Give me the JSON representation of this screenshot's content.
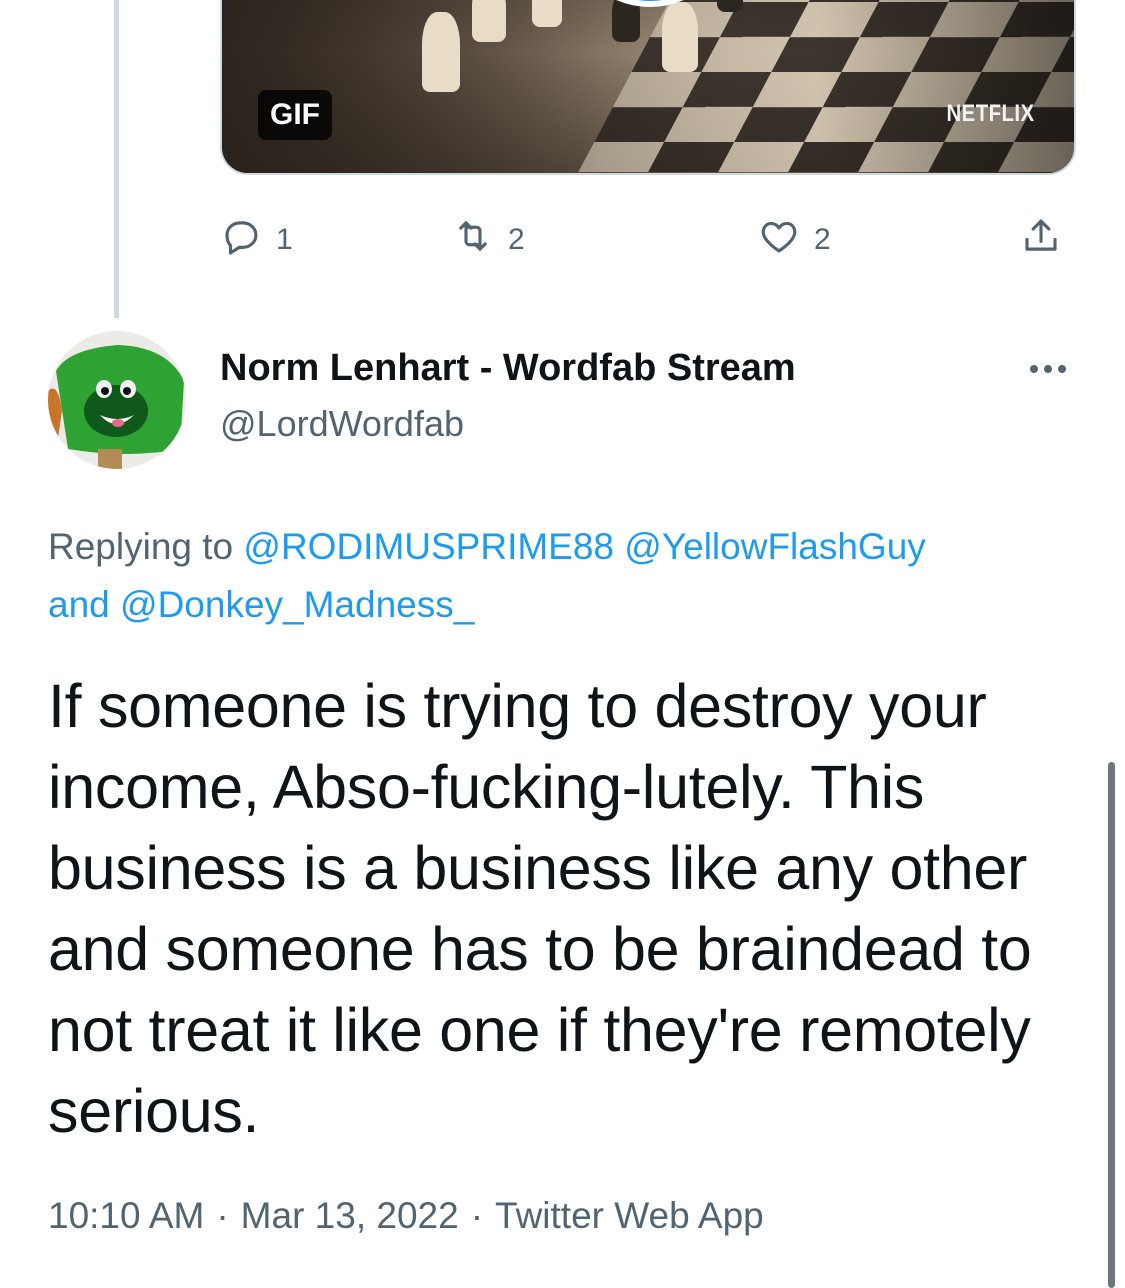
{
  "media": {
    "gif_label": "GIF",
    "watermark": "NETFLIX"
  },
  "actions": {
    "reply_count": "1",
    "retweet_count": "2",
    "like_count": "2"
  },
  "tweet": {
    "author_name": "Norm Lenhart - Wordfab Stream",
    "author_handle": "@LordWordfab",
    "replying_prefix": "Replying to ",
    "mention_1": "@RODIMUSPRIME88",
    "mention_2": "@YellowFlashGuy",
    "replying_and": "and ",
    "mention_3": "@Donkey_Madness_",
    "text": "If someone is trying to destroy your income, Abso-fucking-lutely. This business is a business like any other and someone has to be braindead to not treat it like one if they're remotely serious.",
    "time": "10:10 AM",
    "sep1": "·",
    "date": "Mar 13, 2022",
    "sep2": "·",
    "source": "Twitter Web App"
  },
  "colors": {
    "accent": "#1d9bf0",
    "secondary_text": "#536471",
    "primary_text": "#0f1419"
  }
}
